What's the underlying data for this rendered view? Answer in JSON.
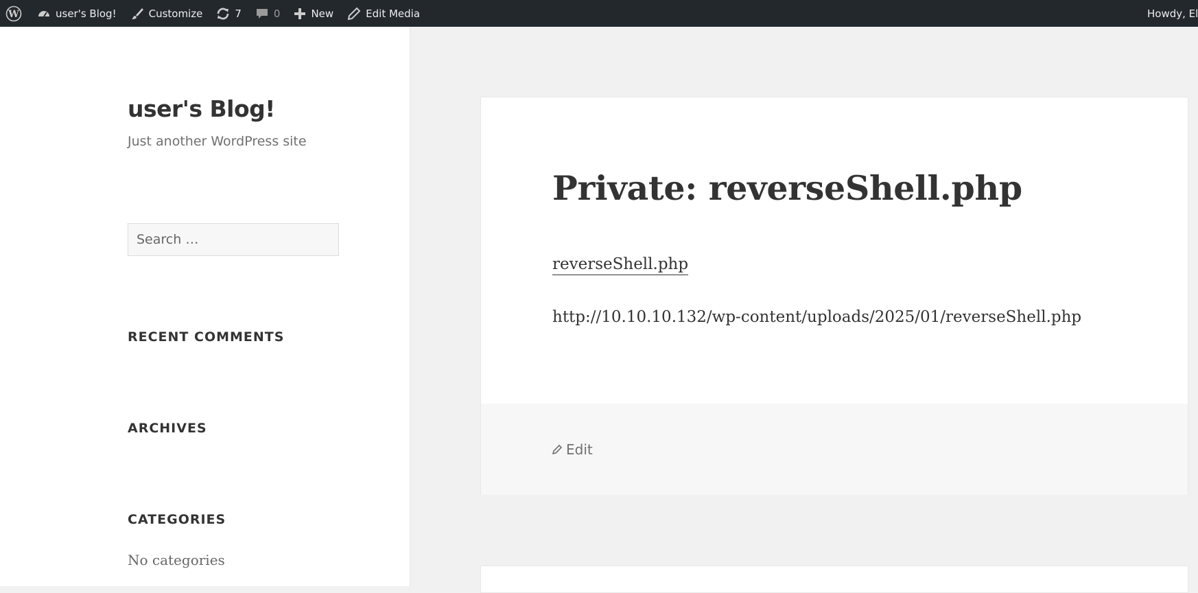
{
  "admin_bar": {
    "site_name": "user's Blog!",
    "customize": "Customize",
    "updates_count": "7",
    "comments_count": "0",
    "new_label": "New",
    "edit_media": "Edit Media",
    "howdy": "Howdy, El"
  },
  "site": {
    "title": "user's Blog!",
    "description": "Just another WordPress site"
  },
  "search": {
    "placeholder": "Search …"
  },
  "widgets": {
    "recent_comments": "RECENT COMMENTS",
    "archives": "ARCHIVES",
    "categories": "CATEGORIES",
    "no_categories": "No categories"
  },
  "post": {
    "title": "Private: reverseShell.php",
    "attachment_link": "reverseShell.php",
    "url_text": "http://10.10.10.132/wp-content/uploads/2025/01/reverseShell.php",
    "edit_label": "Edit"
  },
  "colors": {
    "admin_bar_bg": "#23282d",
    "page_bg": "#f1f1f1",
    "text": "#333333"
  }
}
